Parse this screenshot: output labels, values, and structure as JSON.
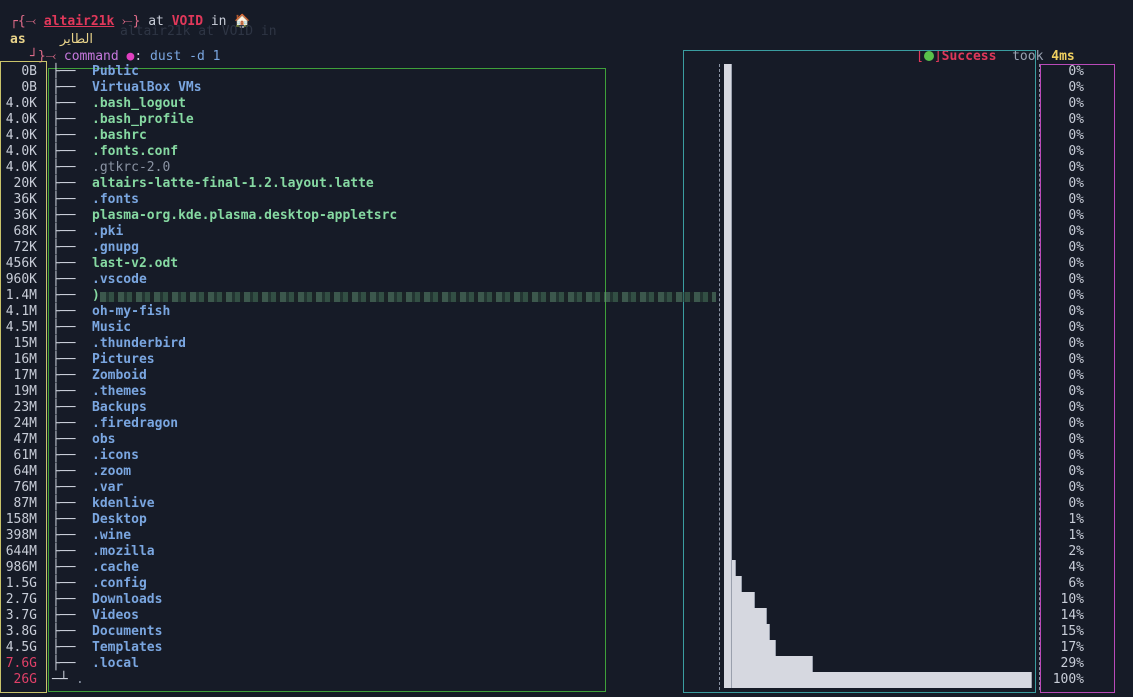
{
  "prompt": {
    "open": "┌{⤙ ",
    "user": "altair21k",
    "close": " ⤚}",
    "at": " at ",
    "host": "VOID",
    "in": " in ",
    "home": "🏠",
    "ghost": "altair21k  at VOID in",
    "as_label": "as",
    "arabic": "الطاير",
    "cmd_prefix": "┘}⤙ ",
    "cmd_word": "command",
    "cmd_sep": ": ",
    "command": "dust -d 1"
  },
  "status": {
    "open": "[",
    "close": "]",
    "label": "Success",
    "took": "took",
    "duration": "4ms"
  },
  "entries": [
    {
      "size": "0B",
      "name": "Public",
      "kind": "dir",
      "pct": "0%"
    },
    {
      "size": "0B",
      "name": "VirtualBox VMs",
      "kind": "dir",
      "pct": "0%"
    },
    {
      "size": "4.0K",
      "name": ".bash_logout",
      "kind": "file",
      "pct": "0%"
    },
    {
      "size": "4.0K",
      "name": ".bash_profile",
      "kind": "file",
      "pct": "0%"
    },
    {
      "size": "4.0K",
      "name": ".bashrc",
      "kind": "file",
      "pct": "0%"
    },
    {
      "size": "4.0K",
      "name": ".fonts.conf",
      "kind": "file",
      "pct": "0%"
    },
    {
      "size": "4.0K",
      "name": ".gtkrc-2.0",
      "kind": "hidden",
      "pct": "0%"
    },
    {
      "size": "20K",
      "name": "altairs-latte-final-1.2.layout.latte",
      "kind": "file",
      "pct": "0%"
    },
    {
      "size": "36K",
      "name": ".fonts",
      "kind": "dir",
      "pct": "0%"
    },
    {
      "size": "36K",
      "name": "plasma-org.kde.plasma.desktop-appletsrc",
      "kind": "file",
      "pct": "0%"
    },
    {
      "size": "68K",
      "name": ".pki",
      "kind": "dir",
      "pct": "0%"
    },
    {
      "size": "72K",
      "name": ".gnupg",
      "kind": "dir",
      "pct": "0%"
    },
    {
      "size": "456K",
      "name": "last-v2.odt",
      "kind": "file",
      "pct": "0%"
    },
    {
      "size": "960K",
      "name": ".vscode",
      "kind": "dir",
      "pct": "0%"
    },
    {
      "size": "1.4M",
      "name": ")",
      "kind": "file",
      "pct": "0%"
    },
    {
      "size": "4.1M",
      "name": "oh-my-fish",
      "kind": "dir",
      "pct": "0%"
    },
    {
      "size": "4.5M",
      "name": "Music",
      "kind": "dir",
      "pct": "0%"
    },
    {
      "size": "15M",
      "name": ".thunderbird",
      "kind": "dir",
      "pct": "0%"
    },
    {
      "size": "16M",
      "name": "Pictures",
      "kind": "dir",
      "pct": "0%"
    },
    {
      "size": "17M",
      "name": "Zomboid",
      "kind": "dir",
      "pct": "0%"
    },
    {
      "size": "19M",
      "name": ".themes",
      "kind": "dir",
      "pct": "0%"
    },
    {
      "size": "23M",
      "name": "Backups",
      "kind": "dir",
      "pct": "0%"
    },
    {
      "size": "24M",
      "name": ".firedragon",
      "kind": "dir",
      "pct": "0%"
    },
    {
      "size": "47M",
      "name": "obs",
      "kind": "dir",
      "pct": "0%"
    },
    {
      "size": "61M",
      "name": ".icons",
      "kind": "dir",
      "pct": "0%"
    },
    {
      "size": "64M",
      "name": ".zoom",
      "kind": "dir",
      "pct": "0%"
    },
    {
      "size": "76M",
      "name": ".var",
      "kind": "dir",
      "pct": "0%"
    },
    {
      "size": "87M",
      "name": "kdenlive",
      "kind": "dir",
      "pct": "0%"
    },
    {
      "size": "158M",
      "name": "Desktop",
      "kind": "dir",
      "pct": "1%"
    },
    {
      "size": "398M",
      "name": ".wine",
      "kind": "dir",
      "pct": "1%"
    },
    {
      "size": "644M",
      "name": ".mozilla",
      "kind": "dir",
      "pct": "2%"
    },
    {
      "size": "986M",
      "name": ".cache",
      "kind": "dir",
      "pct": "4%"
    },
    {
      "size": "1.5G",
      "name": ".config",
      "kind": "dir",
      "pct": "6%"
    },
    {
      "size": "2.7G",
      "name": "Downloads",
      "kind": "dir",
      "pct": "10%"
    },
    {
      "size": "3.7G",
      "name": "Videos",
      "kind": "dir",
      "pct": "14%"
    },
    {
      "size": "3.8G",
      "name": "Documents",
      "kind": "dir",
      "pct": "15%"
    },
    {
      "size": "4.5G",
      "name": "Templates",
      "kind": "dir",
      "pct": "17%"
    },
    {
      "size": "7.6G",
      "name": ".local",
      "kind": "dir",
      "pct": "29%",
      "warn": true
    },
    {
      "size": "26G",
      "name": ".",
      "kind": "hidden",
      "pct": "100%",
      "warn": true,
      "root": true
    }
  ],
  "bar_levels": [
    0,
    0,
    0,
    0,
    0,
    0,
    0,
    0,
    0,
    0,
    0,
    0,
    0,
    0,
    0,
    0,
    0,
    0,
    0,
    0,
    0,
    0,
    0,
    0,
    0,
    0,
    0,
    0,
    0.01,
    0.01,
    0.02,
    0.04,
    0.06,
    0.1,
    0.14,
    0.15,
    0.17,
    0.29,
    1.0
  ],
  "colors": {
    "background": "#161b27",
    "dir": "#7aa6e0",
    "file": "#86d9a2",
    "accent": "#e0385a",
    "size_box": "#c9c36a",
    "tree_box": "#3fa03a",
    "bar_box": "#3a9da0",
    "pct_box": "#b94ab9",
    "bar_fill": "#d6d8e0"
  }
}
